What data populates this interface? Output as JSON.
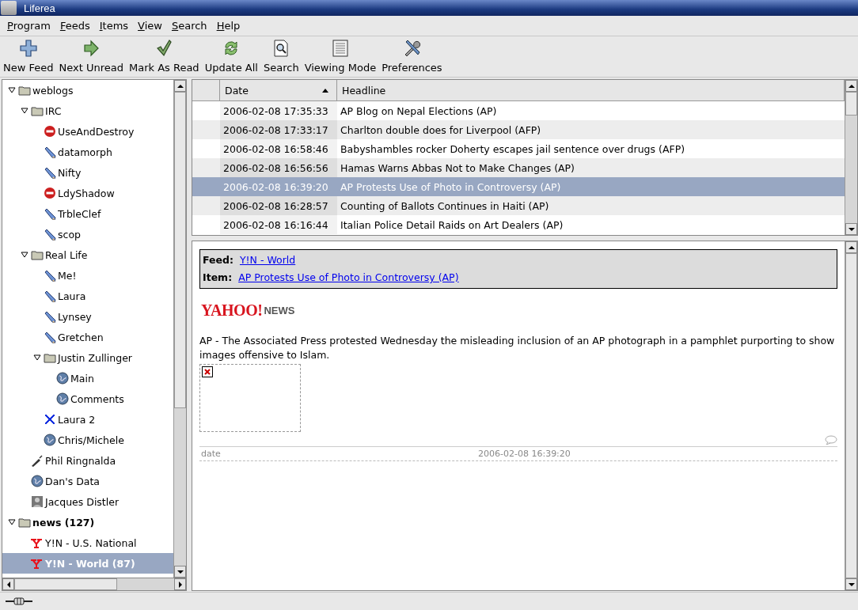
{
  "window": {
    "title": "Liferea"
  },
  "menu": [
    "Program",
    "Feeds",
    "Items",
    "View",
    "Search",
    "Help"
  ],
  "toolbar": [
    "New Feed",
    "Next Unread",
    "Mark As Read",
    "Update All",
    "Search",
    "Viewing Mode",
    "Preferences"
  ],
  "feeds": [
    {
      "label": "weblogs",
      "kind": "folder",
      "expanded": true,
      "selected": false,
      "unread": false,
      "children": [
        {
          "label": "IRC",
          "kind": "folder",
          "expanded": true,
          "selected": false,
          "unread": false,
          "children": [
            {
              "label": "UseAndDestroy",
              "kind": "error",
              "selected": false,
              "unread": false
            },
            {
              "label": "datamorph",
              "kind": "pencil",
              "selected": false,
              "unread": false
            },
            {
              "label": "Nifty",
              "kind": "pencil",
              "selected": false,
              "unread": false
            },
            {
              "label": "LdyShadow",
              "kind": "error",
              "selected": false,
              "unread": false
            },
            {
              "label": "TrbleClef",
              "kind": "pencil",
              "selected": false,
              "unread": false
            },
            {
              "label": "scop",
              "kind": "pencil",
              "selected": false,
              "unread": false
            }
          ]
        },
        {
          "label": "Real Life",
          "kind": "folder",
          "expanded": true,
          "selected": false,
          "unread": false,
          "children": [
            {
              "label": "Me!",
              "kind": "pencil",
              "selected": false,
              "unread": false
            },
            {
              "label": "Laura",
              "kind": "pencil",
              "selected": false,
              "unread": false
            },
            {
              "label": "Lynsey",
              "kind": "pencil",
              "selected": false,
              "unread": false
            },
            {
              "label": "Gretchen",
              "kind": "pencil",
              "selected": false,
              "unread": false
            },
            {
              "label": "Justin Zullinger",
              "kind": "folder",
              "expanded": true,
              "selected": false,
              "unread": false,
              "children": [
                {
                  "label": "Main",
                  "kind": "globe",
                  "selected": false,
                  "unread": false
                },
                {
                  "label": "Comments",
                  "kind": "globe",
                  "selected": false,
                  "unread": false
                }
              ]
            },
            {
              "label": "Laura 2",
              "kind": "x",
              "selected": false,
              "unread": false
            },
            {
              "label": "Chris/Michele",
              "kind": "globe",
              "selected": false,
              "unread": false
            }
          ]
        },
        {
          "label": "Phil Ringnalda",
          "kind": "pen",
          "selected": false,
          "unread": false
        },
        {
          "label": "Dan's Data",
          "kind": "globe",
          "selected": false,
          "unread": false
        },
        {
          "label": "Jacques Distler",
          "kind": "photo",
          "selected": false,
          "unread": false
        }
      ]
    },
    {
      "label": "news (127)",
      "kind": "folder",
      "expanded": true,
      "selected": false,
      "unread": true,
      "children": [
        {
          "label": "Y!N - U.S. National",
          "kind": "yahoo",
          "selected": false,
          "unread": false
        },
        {
          "label": "Y!N - World (87)",
          "kind": "yahoo",
          "selected": true,
          "unread": true
        }
      ]
    }
  ],
  "items": {
    "columns": [
      "Date",
      "Headline"
    ],
    "rows": [
      {
        "date": "2006-02-08 17:35:33",
        "headline": "AP Blog on Nepal Elections (AP)",
        "selected": false
      },
      {
        "date": "2006-02-08 17:33:17",
        "headline": "Charlton double does for Liverpool (AFP)",
        "selected": false
      },
      {
        "date": "2006-02-08 16:58:46",
        "headline": "Babyshambles rocker Doherty escapes jail sentence over drugs (AFP)",
        "selected": false
      },
      {
        "date": "2006-02-08 16:56:56",
        "headline": "Hamas Warns Abbas Not to Make Changes (AP)",
        "selected": false
      },
      {
        "date": "2006-02-08 16:39:20",
        "headline": "AP Protests Use of Photo in Controversy (AP)",
        "selected": true
      },
      {
        "date": "2006-02-08 16:28:57",
        "headline": "Counting of Ballots Continues in Haiti (AP)",
        "selected": false
      },
      {
        "date": "2006-02-08 16:16:44",
        "headline": "Italian Police Detail Raids on Art Dealers (AP)",
        "selected": false
      }
    ]
  },
  "article": {
    "feed_label": "Feed:",
    "feed": "Y!N - World",
    "item_label": "Item:",
    "item": "AP Protests Use of Photo in Controversy (AP)",
    "logo": "YAHOO!",
    "logo_suffix": "NEWS",
    "body": "AP - The Associated Press protested Wednesday the misleading inclusion of an AP photograph in a pamphlet purporting to show images offensive to Islam.",
    "date_label": "date",
    "date": "2006-02-08 16:39:20"
  }
}
